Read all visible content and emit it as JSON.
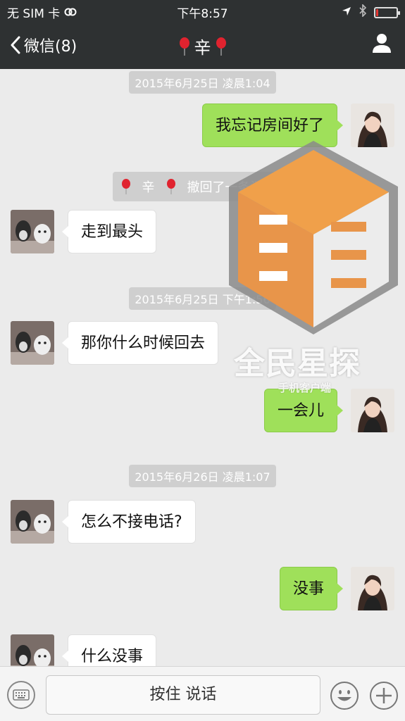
{
  "status_bar": {
    "carrier": "无 SIM 卡",
    "time": "下午8:57",
    "battery_level": 0.12
  },
  "nav": {
    "back_label": "微信(8)",
    "contact_name": "辛"
  },
  "messages": [
    {
      "kind": "timestamp",
      "text": "2015年6月25日 凌晨1:04"
    },
    {
      "kind": "out",
      "text": "我忘记房间好了"
    },
    {
      "kind": "system",
      "name": "辛",
      "text": "撤回了一条消息"
    },
    {
      "kind": "in",
      "text": "走到最头"
    },
    {
      "kind": "timestamp",
      "text": "2015年6月25日 下午1:56"
    },
    {
      "kind": "in",
      "text": "那你什么时候回去"
    },
    {
      "kind": "out",
      "text": "一会儿"
    },
    {
      "kind": "timestamp",
      "text": "2015年6月26日 凌晨1:07"
    },
    {
      "kind": "in",
      "text": "怎么不接电话?"
    },
    {
      "kind": "out",
      "text": "没事"
    },
    {
      "kind": "in",
      "text": "什么没事"
    }
  ],
  "watermark": {
    "title": "全民星探",
    "subtitle": "手机客户端"
  },
  "input_bar": {
    "hold_to_talk": "按住 说话"
  },
  "colors": {
    "header": "#2e3132",
    "chat_bg": "#ebebeb",
    "out_bubble": "#9fe05a",
    "in_bubble": "#ffffff"
  }
}
